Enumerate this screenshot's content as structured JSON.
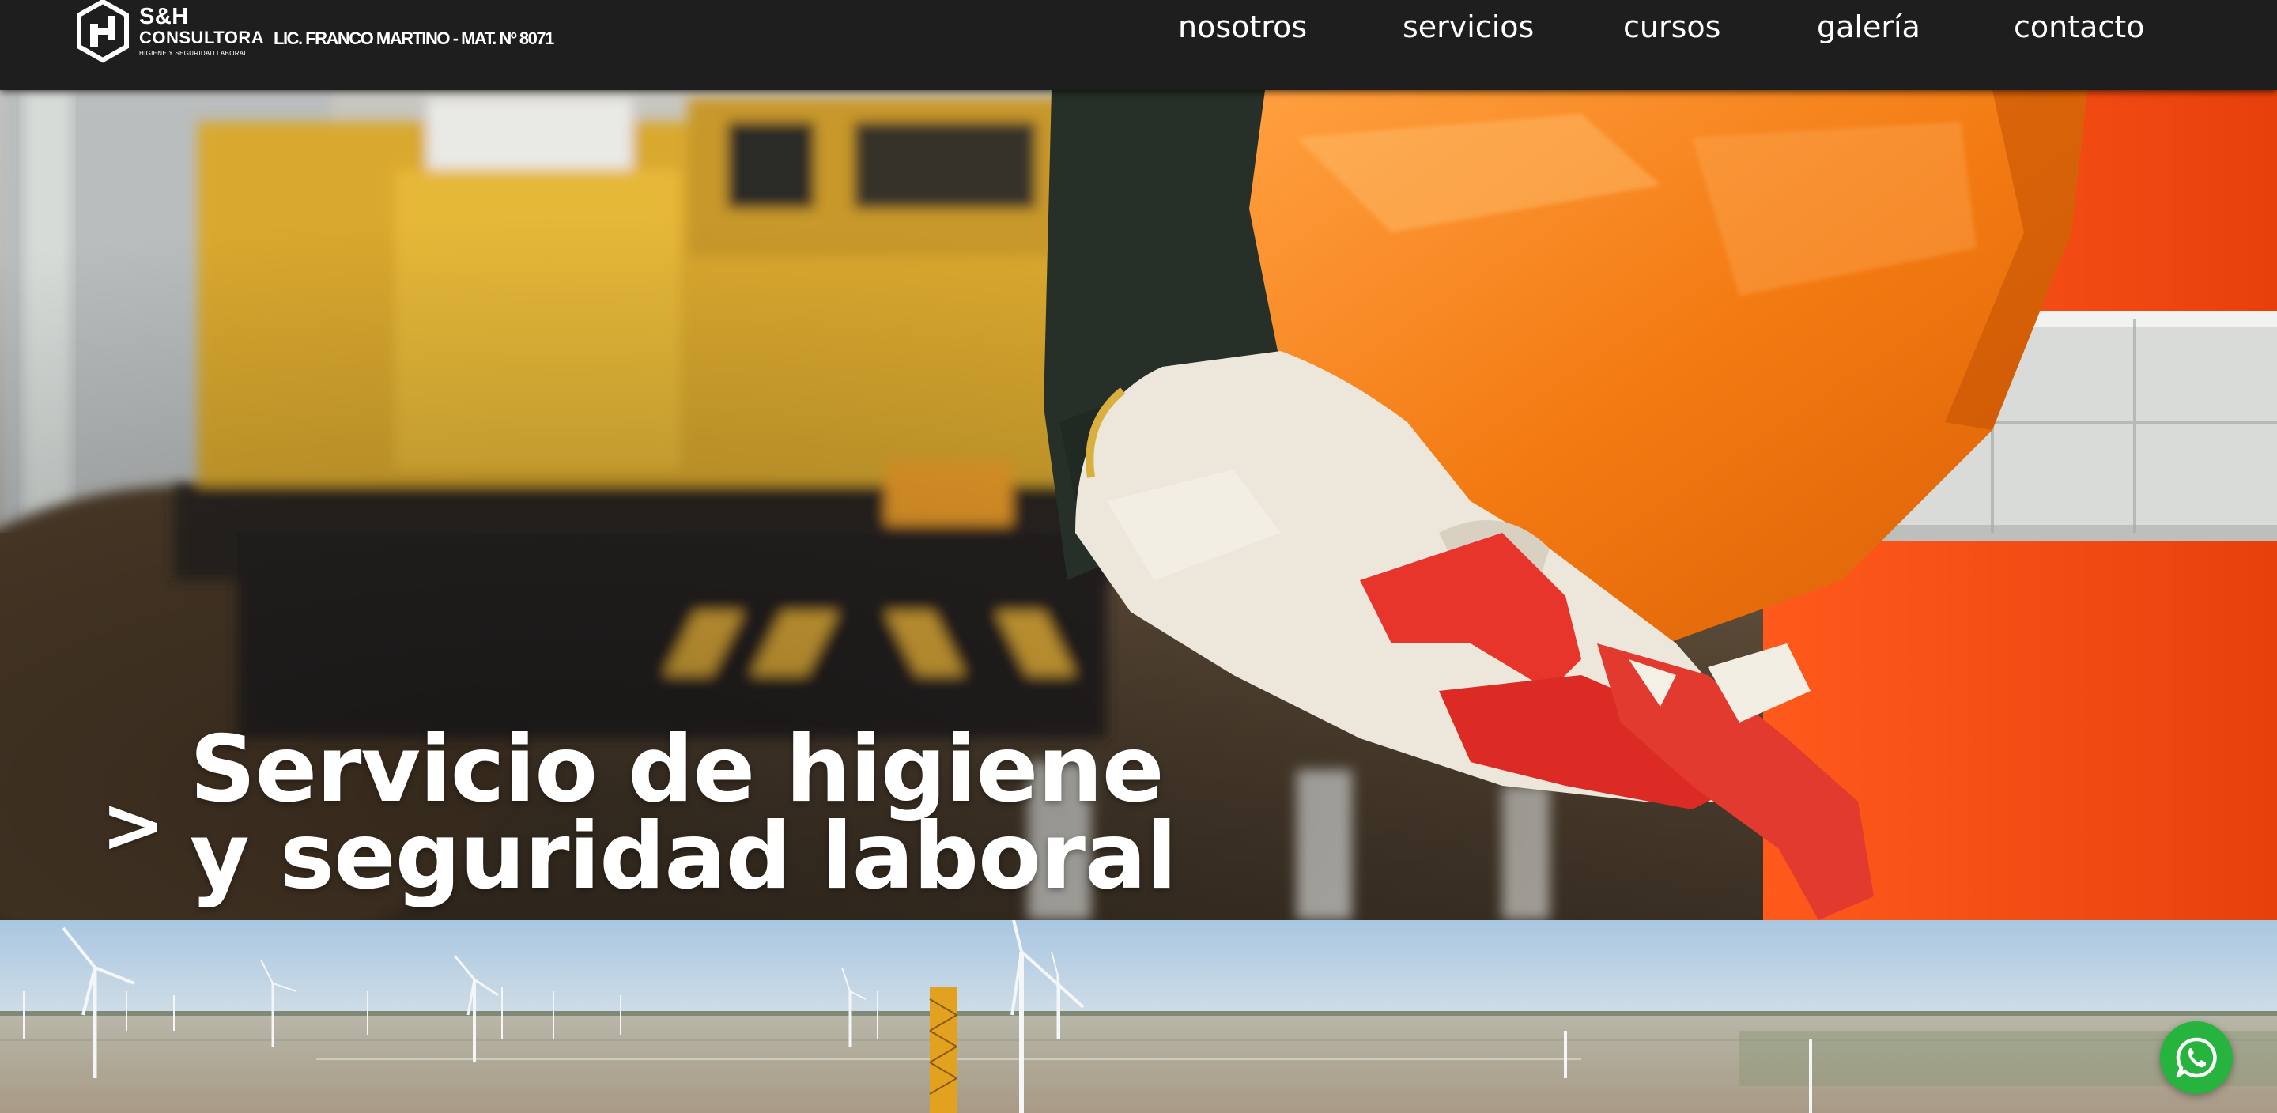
{
  "brand": {
    "name_line1": "S&H",
    "name_line2": "CONSULTORA",
    "tagline": "HIGIENE Y SEGURIDAD LABORAL",
    "license": "LIC. FRANCO MARTINO - MAT. Nº 8071"
  },
  "nav": {
    "items": [
      {
        "label": "nosotros"
      },
      {
        "label": "servicios"
      },
      {
        "label": "cursos"
      },
      {
        "label": "galería"
      },
      {
        "label": "contacto"
      }
    ]
  },
  "hero": {
    "arrow": ">",
    "headline_line1": "Servicio de higiene",
    "headline_line2": "y seguridad laboral"
  },
  "widgets": {
    "whatsapp_icon": "whatsapp-icon"
  },
  "colors": {
    "header_bg": "#1e1e1e",
    "whatsapp_green": "#27b43e",
    "accent_orange": "#f07a10"
  }
}
